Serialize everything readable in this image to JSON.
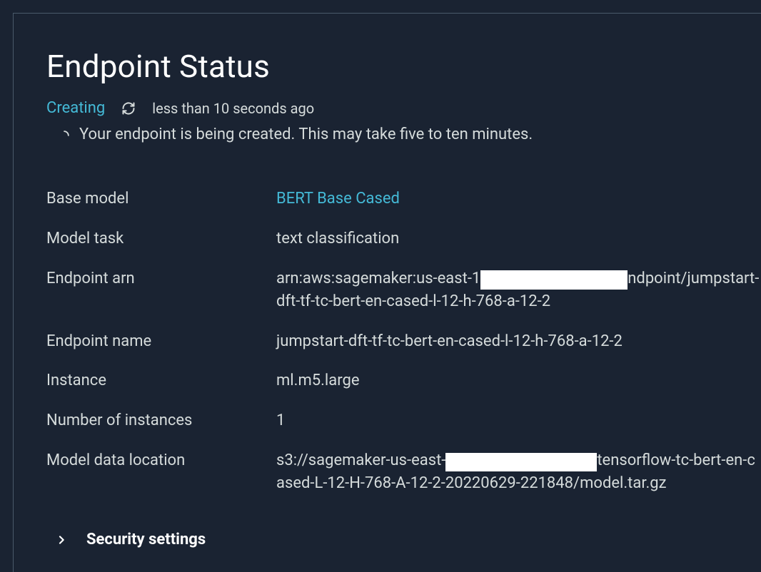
{
  "title": "Endpoint Status",
  "status": {
    "state": "Creating",
    "age": "less than 10 seconds ago",
    "message": "Your endpoint is being created. This may take five to ten minutes."
  },
  "labels": {
    "base_model": "Base model",
    "model_task": "Model task",
    "endpoint_arn": "Endpoint arn",
    "endpoint_name": "Endpoint name",
    "instance": "Instance",
    "number_of_instances": "Number of instances",
    "model_data_location": "Model data location"
  },
  "values": {
    "base_model": "BERT Base Cased",
    "model_task": "text classification",
    "endpoint_arn_pre": "arn:aws:sagemaker:us-east-1",
    "endpoint_arn_post": "ndpoint/jumpstart-dft-tf-tc-bert-en-cased-l-12-h-768-a-12-2",
    "endpoint_name": "jumpstart-dft-tf-tc-bert-en-cased-l-12-h-768-a-12-2",
    "instance": "ml.m5.large",
    "number_of_instances": "1",
    "model_data_location_pre": "s3://sagemaker-us-east-",
    "model_data_location_post": "tensorflow-tc-bert-en-cased-L-12-H-768-A-12-2-20220629-221848/model.tar.gz"
  },
  "sections": {
    "security_settings": "Security settings"
  }
}
